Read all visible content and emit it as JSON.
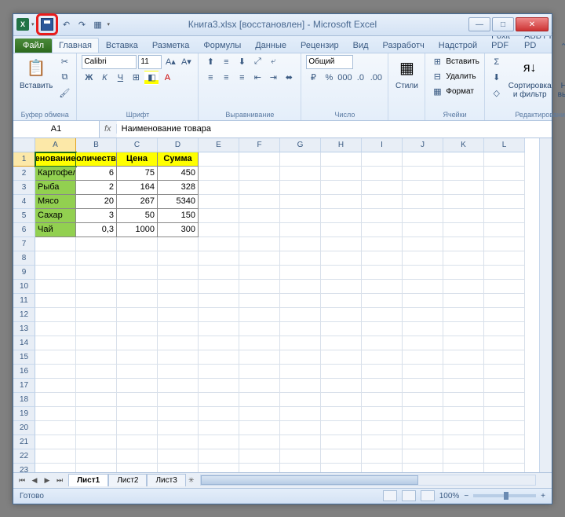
{
  "title": "Книга3.xlsx [восстановлен] - Microsoft Excel",
  "qat": {
    "undo": "↶",
    "redo": "↷",
    "new": "▦"
  },
  "win": {
    "min": "—",
    "max": "□",
    "close": "✕"
  },
  "tabs": {
    "file": "Файл",
    "items": [
      "Главная",
      "Вставка",
      "Разметка",
      "Формулы",
      "Данные",
      "Рецензир",
      "Вид",
      "Разработч",
      "Надстрой",
      "Foxit PDF",
      "ABBYY PD"
    ]
  },
  "ribbon": {
    "clipboard": {
      "paste": "Вставить",
      "label": "Буфер обмена"
    },
    "font": {
      "name": "Calibri",
      "size": "11",
      "bold": "Ж",
      "italic": "К",
      "underline": "Ч",
      "label": "Шрифт"
    },
    "align": {
      "label": "Выравнивание"
    },
    "number": {
      "format": "Общий",
      "label": "Число"
    },
    "styles": {
      "btn": "Стили",
      "label": ""
    },
    "cells": {
      "insert": "Вставить",
      "delete": "Удалить",
      "format": "Формат",
      "label": "Ячейки"
    },
    "editing": {
      "sort": "Сортировка и фильтр",
      "find": "Найти и выделить",
      "label": "Редактирование"
    }
  },
  "formula": {
    "cell_ref": "A1",
    "fx": "fx",
    "value": "Наименование товара"
  },
  "cols": [
    "A",
    "B",
    "C",
    "D",
    "E",
    "F",
    "G",
    "H",
    "I",
    "J",
    "K",
    "L"
  ],
  "rows_count": 25,
  "header_row": [
    "енование",
    "оличеств",
    "Цена",
    "Сумма"
  ],
  "data_rows": [
    [
      "Картофел",
      "6",
      "75",
      "450"
    ],
    [
      "Рыба",
      "2",
      "164",
      "328"
    ],
    [
      "Мясо",
      "20",
      "267",
      "5340"
    ],
    [
      "Сахар",
      "3",
      "50",
      "150"
    ],
    [
      "Чай",
      "0,3",
      "1000",
      "300"
    ]
  ],
  "sheets": [
    "Лист1",
    "Лист2",
    "Лист3"
  ],
  "status": {
    "ready": "Готово",
    "zoom": "100%"
  }
}
